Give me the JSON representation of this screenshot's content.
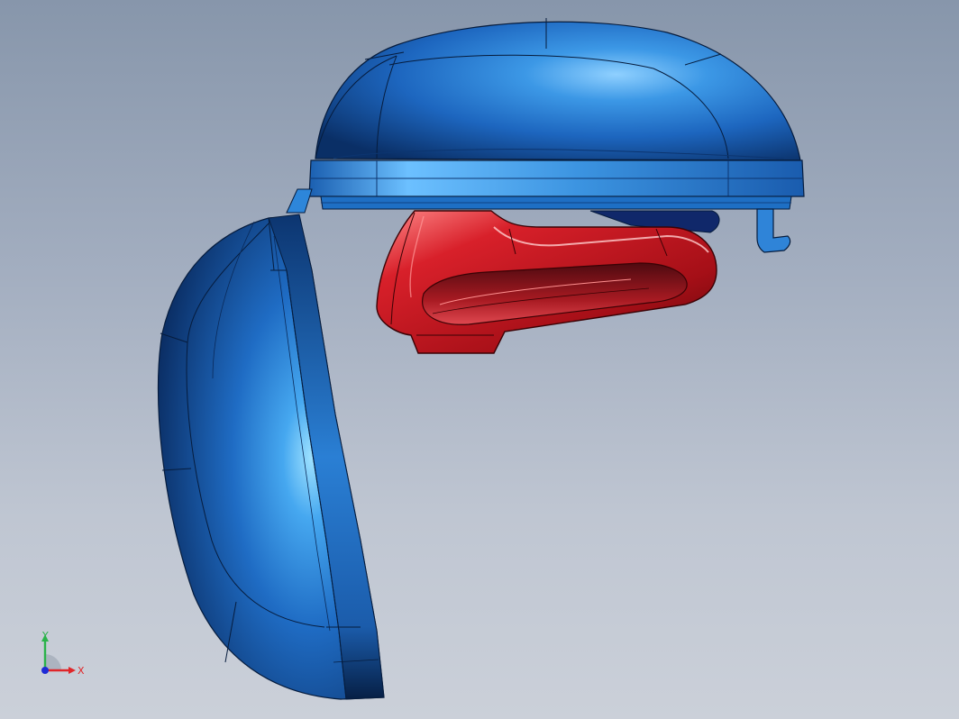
{
  "viewport": {
    "background_top": "#8796ab",
    "background_bottom": "#cbd0d9"
  },
  "model": {
    "parts": [
      {
        "name": "housing-top-cover",
        "color": "#1f74c9"
      },
      {
        "name": "housing-side-cover",
        "color": "#1f74c9"
      },
      {
        "name": "mirror-frame",
        "color": "#b3121a"
      },
      {
        "name": "mounting-clip",
        "color": "#2f84d8"
      }
    ]
  },
  "triad": {
    "x_label": "X",
    "y_label": "Y",
    "x_color": "#e0262a",
    "y_color": "#2bb34a",
    "z_color": "#1e2bd6"
  }
}
